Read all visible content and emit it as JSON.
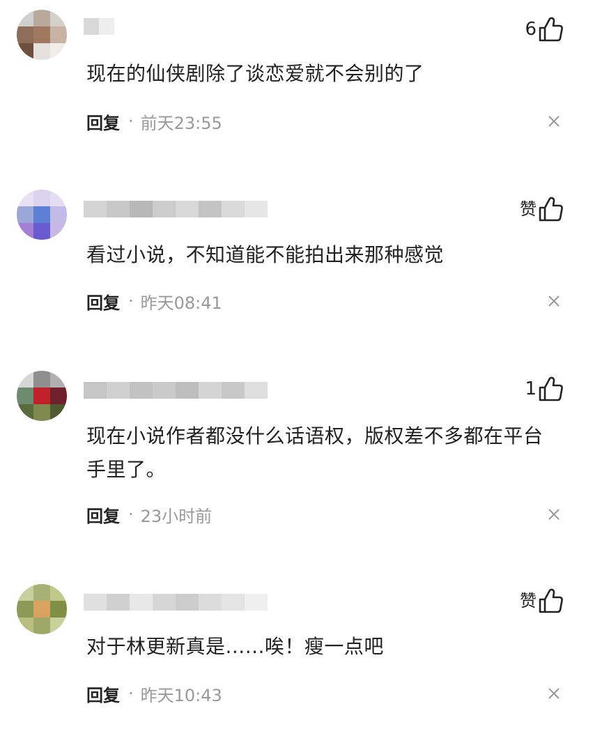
{
  "comments": [
    {
      "like": "6",
      "text": "现在的仙侠剧除了谈恋爱就不会别的了",
      "reply": "回复",
      "separator": "·",
      "time": "前天23:55",
      "avatar_colors": [
        "#cfcfcf",
        "#b9a89c",
        "#d6d0ca",
        "#8f6d5b",
        "#a0785f",
        "#c7b2a3",
        "#6e4e3e",
        "#e5e0dc",
        "#f0ece8"
      ],
      "name_colors": [
        "#d8d8d8",
        "#eeeeee"
      ]
    },
    {
      "like": "赞",
      "text": "看过小说，不知道能不能拍出来那种感觉",
      "reply": "回复",
      "separator": "·",
      "time": "昨天08:41",
      "avatar_colors": [
        "#e8e0f5",
        "#dcd4ee",
        "#e4dcf2",
        "#9aa7d8",
        "#5d7fd3",
        "#c2bbe8",
        "#a37fd6",
        "#6a5ad0",
        "#c8b8ea"
      ],
      "name_colors": [
        "#d4d4d4",
        "#c8c8c8",
        "#b8b8b8",
        "#cccccc",
        "#d8d8d8",
        "#c4c4c4",
        "#dadada",
        "#e6e6e6"
      ]
    },
    {
      "like": "1",
      "text": "现在小说作者都没什么话语权，版权差不多都在平台手里了。",
      "reply": "回复",
      "separator": "·",
      "time": "23小时前",
      "avatar_colors": [
        "#d7d7d7",
        "#8f8f8f",
        "#b0b0b0",
        "#6e8a6f",
        "#c0202a",
        "#70202a",
        "#5a6a3a",
        "#7f8a50",
        "#4d5a30"
      ],
      "name_colors": [
        "#c6c6c6",
        "#d0d0d0",
        "#c2c2c2",
        "#cacaca",
        "#bdbdbd",
        "#d4d4d4",
        "#c8c8c8",
        "#dedede"
      ]
    },
    {
      "like": "赞",
      "text": "对于林更新真是......唉！瘦一点吧",
      "reply": "回复",
      "separator": "·",
      "time": "昨天10:43",
      "avatar_colors": [
        "#c8cf9e",
        "#a7b176",
        "#c0c88a",
        "#8d9a55",
        "#d9a25e",
        "#7f8f45",
        "#b8bf80",
        "#9ea868",
        "#c9d09a"
      ],
      "name_colors": [
        "#e0e0e0",
        "#d0d0d0",
        "#e8e8e8",
        "#d6d6d6",
        "#cccccc",
        "#dcdcdc",
        "#e4e4e4",
        "#efefef"
      ]
    }
  ],
  "icons": {
    "like": "thumbs-up-icon",
    "close": "close-icon"
  }
}
